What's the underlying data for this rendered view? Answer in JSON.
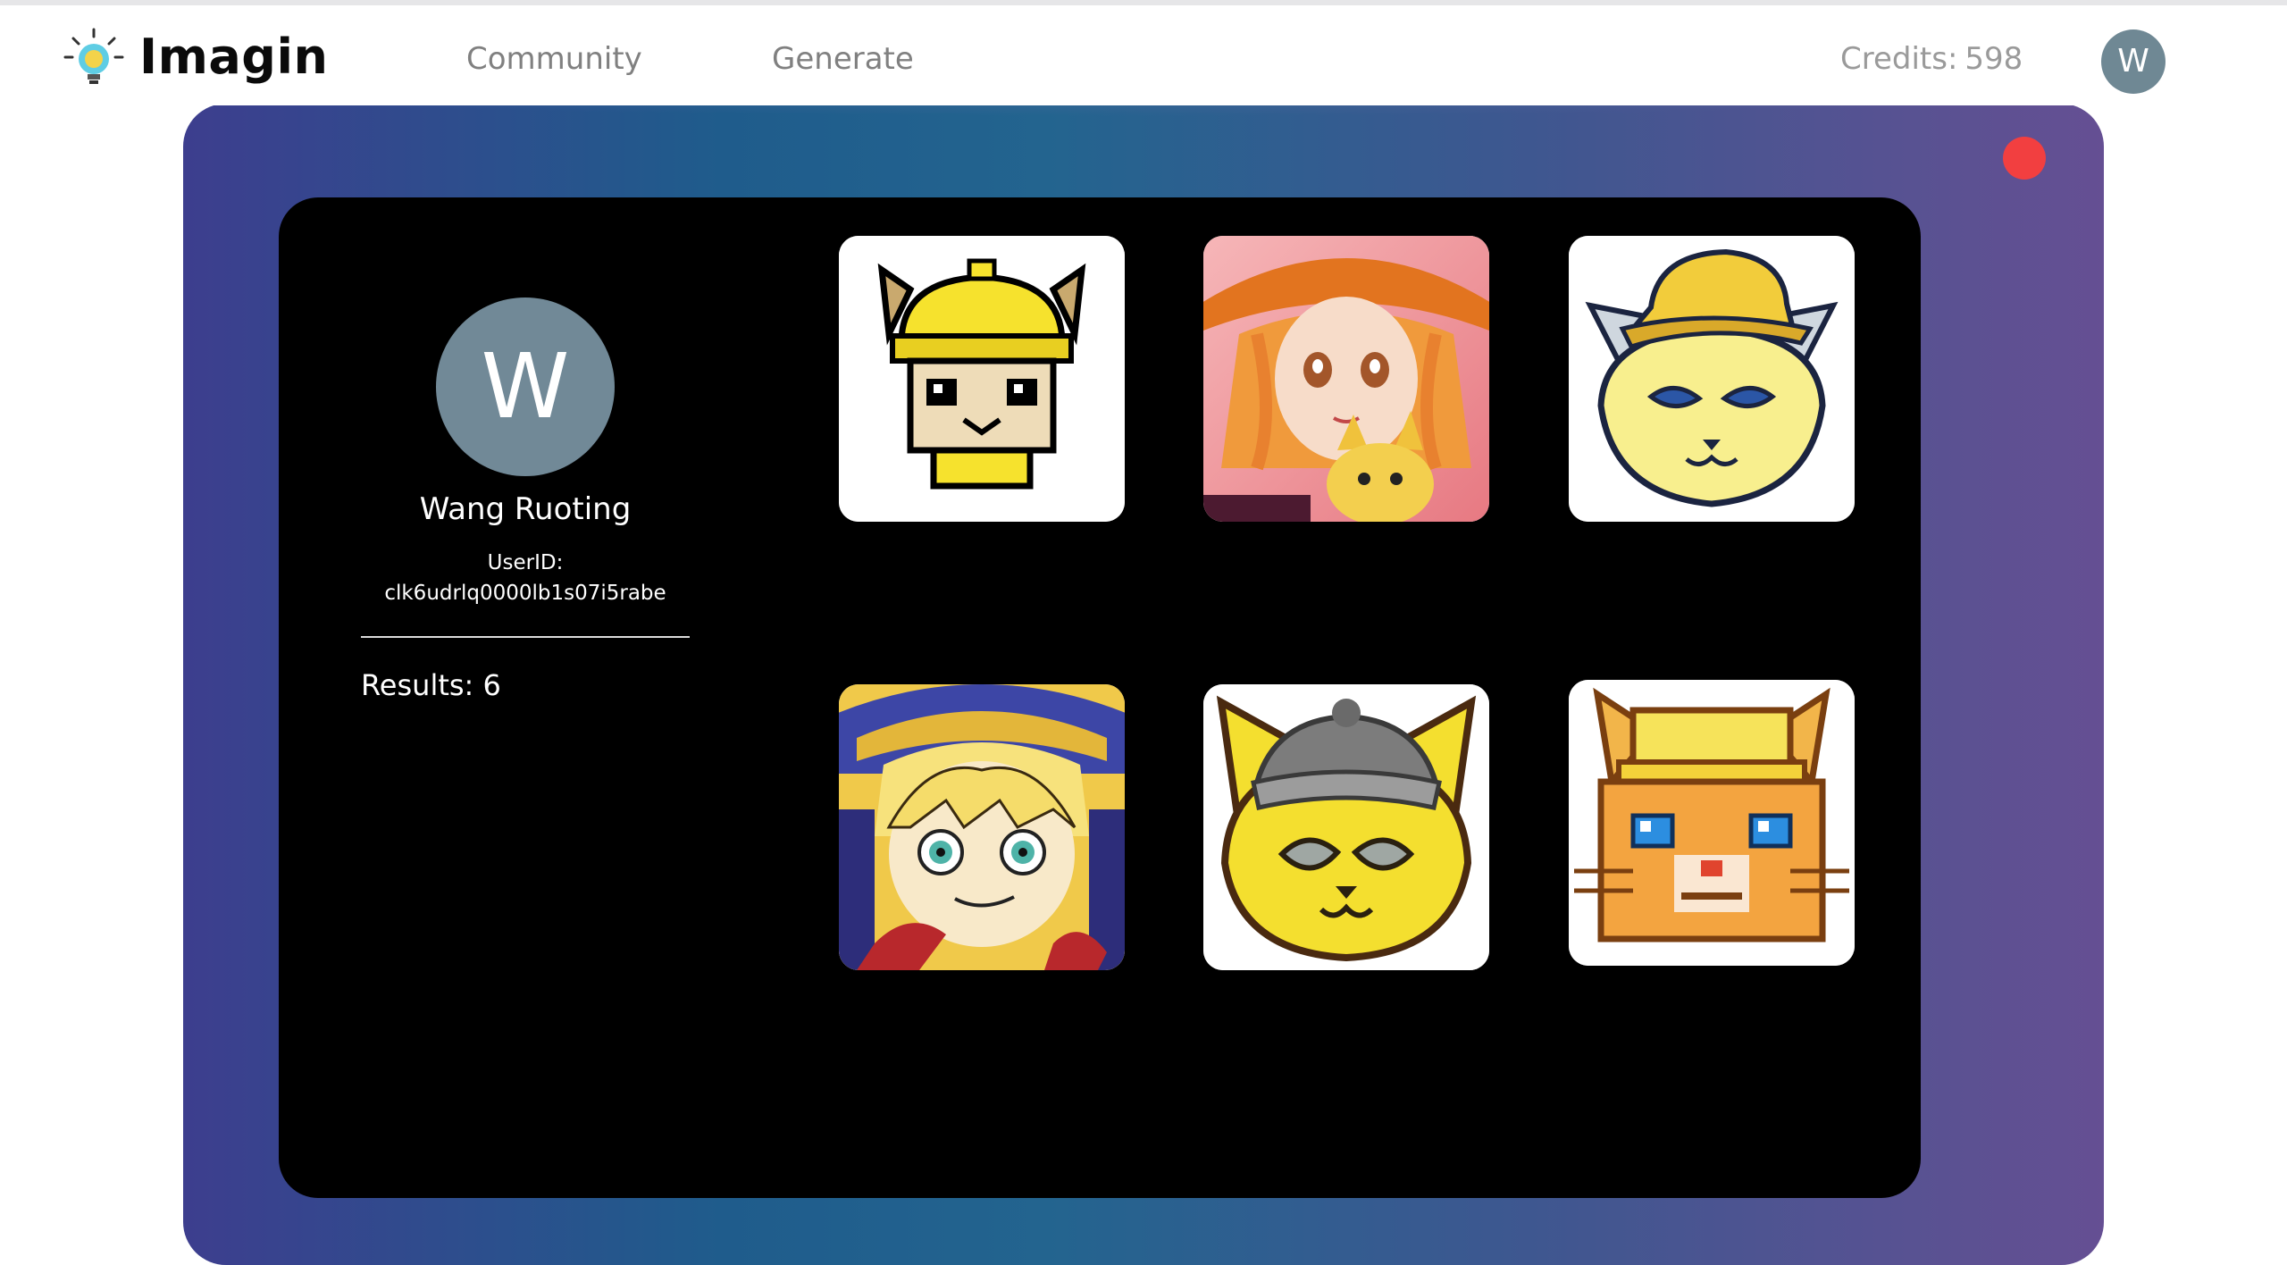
{
  "app": {
    "name": "Imagin",
    "logo_icon": "lightbulb-icon"
  },
  "nav": {
    "links": [
      {
        "label": "Community"
      },
      {
        "label": "Generate"
      }
    ],
    "credits_label": "Credits:",
    "credits_value": "598",
    "avatar_initial": "W"
  },
  "profile": {
    "avatar_initial": "W",
    "name": "Wang Ruoting",
    "userid_label": "UserID:",
    "userid_value": "clk6udrlq0000lb1s07i5rabe",
    "results_label": "Results:",
    "results_count": "6"
  },
  "gallery": {
    "images": [
      {
        "name": "pixel-cat-yellow-hat"
      },
      {
        "name": "anime-girl-orange-hat-with-cat"
      },
      {
        "name": "cartoon-cat-yellow-cap"
      },
      {
        "name": "anime-boy-blue-hat"
      },
      {
        "name": "yellow-cat-gray-beanie"
      },
      {
        "name": "pixel-orange-cat-yellow-hat"
      }
    ]
  },
  "colors": {
    "close_dot": "#f23f40",
    "avatar_bg": "#718997",
    "card_bg": "#000000"
  }
}
